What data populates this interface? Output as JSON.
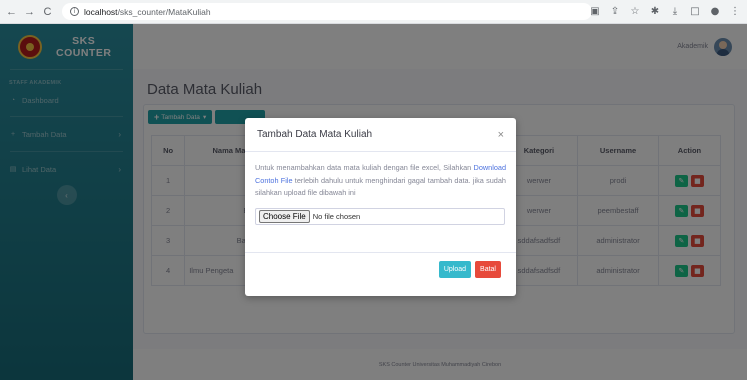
{
  "browser": {
    "url_host": "localhost",
    "url_path": "/sks_counter/MataKuliah"
  },
  "sidebar": {
    "brand": "SKS\nCOUNTER",
    "heading": "STAFF AKADEMIK",
    "items": [
      {
        "label": "Dashboard",
        "icon": "dashboard-icon"
      },
      {
        "label": "Tambah Data",
        "icon": "plus-icon"
      },
      {
        "label": "Lihat Data",
        "icon": "table-icon"
      }
    ]
  },
  "topbar": {
    "user": "Akademik"
  },
  "main": {
    "title": "Data Mata Kuliah",
    "add_button": "Tambah Data",
    "table": {
      "headers": [
        "No",
        "Nama Ma",
        "",
        "",
        "",
        "Kategori",
        "Username",
        "Action"
      ],
      "rows": [
        {
          "no": "1",
          "nama": "Al",
          "kategori": "werwer",
          "username": "prodi"
        },
        {
          "no": "2",
          "nama": "Bahasa",
          "kategori": "werwer",
          "username": "peembestaff"
        },
        {
          "no": "3",
          "nama": "Bahasa Ir",
          "kategori": "sddafsadfsdf",
          "username": "administrator"
        },
        {
          "no": "4",
          "nama": "Ilmu Pengeta",
          "extra": "n",
          "kategori": "sddafsadfsdf",
          "username": "administrator"
        }
      ]
    }
  },
  "footer": "SKS Counter Universitas Muhammadiyah Cirebon",
  "modal": {
    "title": "Tambah Data Mata Kuliah",
    "close": "×",
    "text_before": "Untuk menambahkan data mata kuliah dengan file excel, Silahkan ",
    "link": "Download Contoh File",
    "text_after": " terlebih dahulu untuk menghindari gagal tambah data. jika sudah silahkan upload file dibawah ini",
    "file_button": "Choose File",
    "file_status": "No file chosen",
    "upload": "Upload",
    "cancel": "Batal"
  }
}
